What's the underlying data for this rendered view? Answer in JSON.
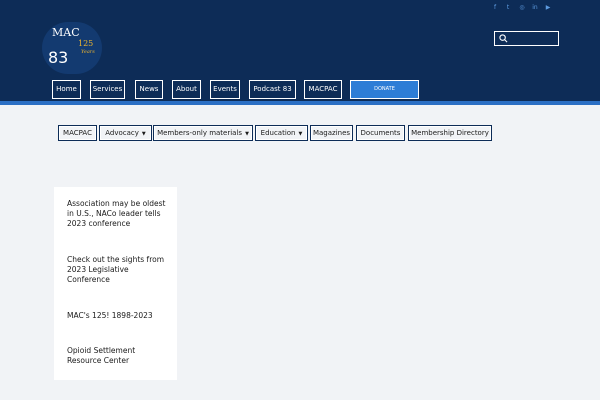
{
  "logo": {
    "mac": "MAC",
    "number": "83",
    "anniversary": "125",
    "years_text": "Years"
  },
  "social_icons": [
    "facebook-icon",
    "twitter-icon",
    "instagram-icon",
    "linkedin-icon",
    "youtube-icon"
  ],
  "social_glyphs": [
    "f",
    "t",
    "◎",
    "in",
    "▶"
  ],
  "search": {
    "placeholder": ""
  },
  "nav": {
    "items": [
      "Home",
      "Services",
      "News",
      "About",
      "Events",
      "Podcast 83",
      "MACPAC"
    ],
    "donate": "DONATE"
  },
  "subnav": {
    "items": [
      {
        "label": "MACPAC",
        "dropdown": false
      },
      {
        "label": "Advocacy",
        "dropdown": true
      },
      {
        "label": "Members-only materials",
        "dropdown": true
      },
      {
        "label": "Education",
        "dropdown": true
      },
      {
        "label": "Magazines",
        "dropdown": false
      },
      {
        "label": "Documents",
        "dropdown": false
      },
      {
        "label": "Membership Directory",
        "dropdown": false
      }
    ],
    "caret": "▼"
  },
  "sidebar": {
    "links": [
      "Association may be oldest in U.S., NACo leader tells 2023 conference",
      "Check out the sights from 2023 Legislative Conference",
      "MAC's 125! 1898-2023",
      "Opioid Settlement Resource Center"
    ]
  },
  "colors": {
    "header": "#0d2c57",
    "accent": "#2b6fc4",
    "donate": "#2d7dd6",
    "background": "#f1f3f6"
  }
}
